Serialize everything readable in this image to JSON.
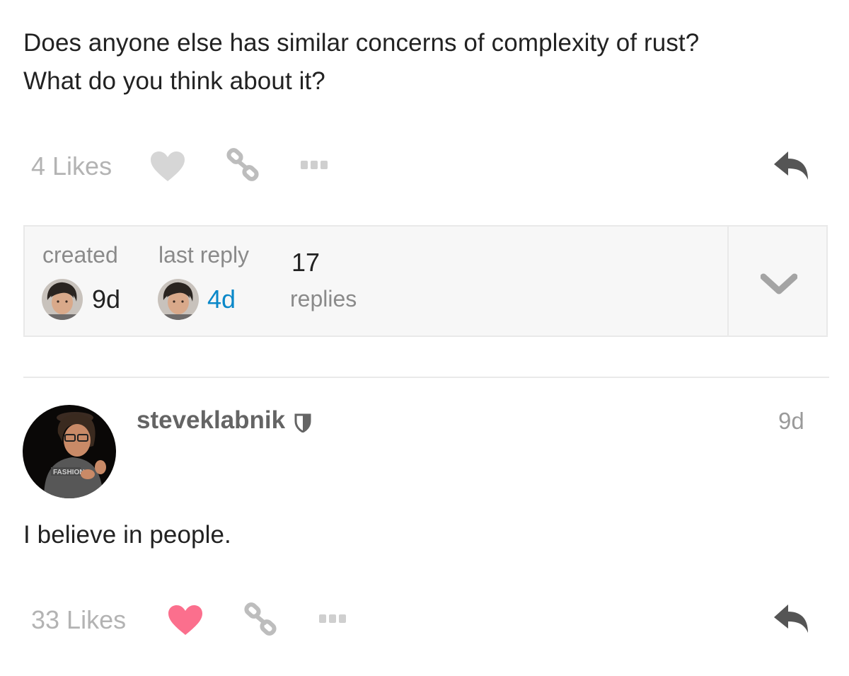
{
  "post1": {
    "text_line1": "Does anyone else has similar concerns of complexity of rust?",
    "text_line2": "What do you think about it?",
    "likes_label": "4 Likes"
  },
  "topic_map": {
    "created_label": "created",
    "created_value": "9d",
    "last_reply_label": "last reply",
    "last_reply_value": "4d",
    "replies_count": "17",
    "replies_label": "replies"
  },
  "post2": {
    "username": "steveklabnik",
    "date": "9d",
    "body": "I believe in people.",
    "likes_label": "33 Likes",
    "avatar_shirt_text": "FASHION"
  },
  "colors": {
    "liked_heart": "#fb6f8d",
    "unliked_heart": "#d6d6d6",
    "link_blue": "#0a88c9"
  }
}
